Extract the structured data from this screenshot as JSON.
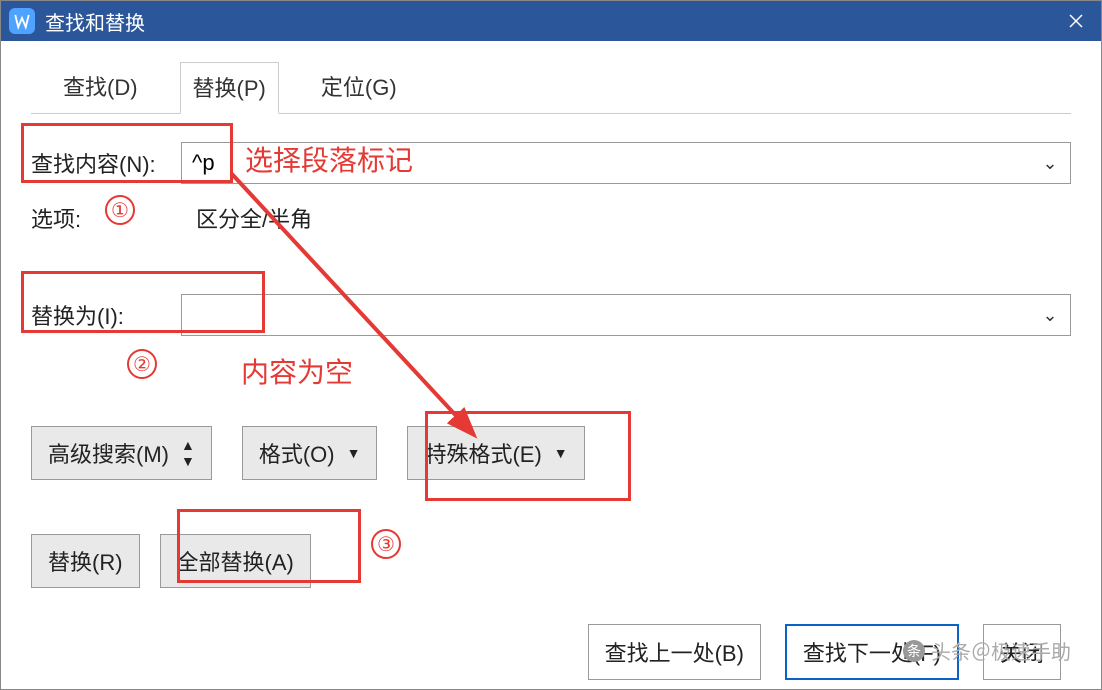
{
  "titlebar": {
    "title": "查找和替换"
  },
  "tabs": {
    "find": "查找(D)",
    "replace": "替换(P)",
    "goto": "定位(G)"
  },
  "findRow": {
    "label": "查找内容(N):",
    "value": "^p"
  },
  "optionsRow": {
    "label": "选项:",
    "value": "区分全/半角"
  },
  "replaceRow": {
    "label": "替换为(I):",
    "value": ""
  },
  "midButtons": {
    "advanced": "高级搜索(M)",
    "format": "格式(O)",
    "special": "特殊格式(E)"
  },
  "bottom1": {
    "replace": "替换(R)",
    "replaceAll": "全部替换(A)"
  },
  "bottom2": {
    "findPrev": "查找上一处(B)",
    "findNext": "查找下一处(F)",
    "close": "关闭"
  },
  "annotations": {
    "t1": "选择段落标记",
    "t2": "内容为空",
    "c1": "①",
    "c2": "②",
    "c3": "③"
  },
  "watermark": "头条＠极速手助"
}
